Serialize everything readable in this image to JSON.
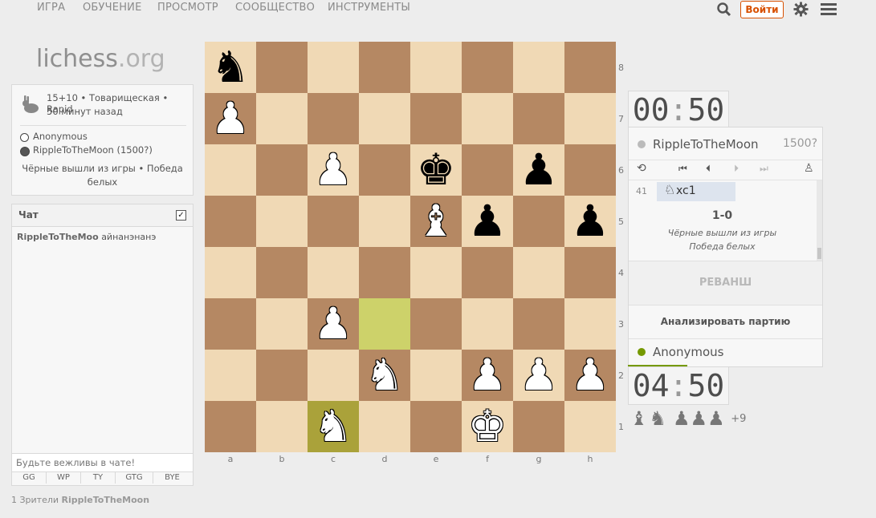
{
  "nav": {
    "items": [
      "ИГРА",
      "ОБУЧЕНИЕ",
      "ПРОСМОТР",
      "СООБЩЕСТВО",
      "ИНСТРУМЕНТЫ"
    ],
    "login_label": "Войти"
  },
  "logo": {
    "main": "lichess",
    "suffix": ".org"
  },
  "game_info": {
    "mode": "15+10 • Товарищеская • Rapid",
    "time_ago": "50 минут назад",
    "white_player": "Anonymous",
    "black_player": "RippleToTheMoon (1500?)",
    "result_text": "Чёрные вышли из игры • Победа белых"
  },
  "chat": {
    "title": "Чат",
    "message_user": "RippleToTheMoo",
    "message_text": "айнанэнанэ",
    "input_placeholder": "Будьте вежливы в чате!",
    "presets": [
      "GG",
      "WP",
      "TY",
      "GTG",
      "BYE"
    ]
  },
  "spectators": {
    "count_label": "1 Зрители",
    "user": "RippleToTheMoon"
  },
  "board": {
    "files": [
      "a",
      "b",
      "c",
      "d",
      "e",
      "f",
      "g",
      "h"
    ],
    "ranks": [
      "8",
      "7",
      "6",
      "5",
      "4",
      "3",
      "2",
      "1"
    ],
    "pieces": [
      {
        "sq": "a8",
        "glyph": "♞",
        "color": "black",
        "name": "black-knight-a8"
      },
      {
        "sq": "a7",
        "glyph": "♟",
        "color": "white",
        "name": "white-pawn-a7"
      },
      {
        "sq": "c6",
        "glyph": "♟",
        "color": "white",
        "name": "white-pawn-c6"
      },
      {
        "sq": "e6",
        "glyph": "♚",
        "color": "black",
        "name": "black-king-e6"
      },
      {
        "sq": "g6",
        "glyph": "♟",
        "color": "black",
        "name": "black-pawn-g6"
      },
      {
        "sq": "e5",
        "glyph": "♝",
        "color": "white",
        "name": "white-bishop-e5"
      },
      {
        "sq": "f5",
        "glyph": "♟",
        "color": "black",
        "name": "black-pawn-f5"
      },
      {
        "sq": "h5",
        "glyph": "♟",
        "color": "black",
        "name": "black-pawn-h5"
      },
      {
        "sq": "c3",
        "glyph": "♟",
        "color": "white",
        "name": "white-pawn-c3"
      },
      {
        "sq": "d2",
        "glyph": "♞",
        "color": "white",
        "name": "white-knight-d2"
      },
      {
        "sq": "f2",
        "glyph": "♟",
        "color": "white",
        "name": "white-pawn-f2"
      },
      {
        "sq": "g2",
        "glyph": "♟",
        "color": "white",
        "name": "white-pawn-g2"
      },
      {
        "sq": "h2",
        "glyph": "♟",
        "color": "white",
        "name": "white-pawn-h2"
      },
      {
        "sq": "c1",
        "glyph": "♞",
        "color": "white",
        "name": "white-knight-c1"
      },
      {
        "sq": "f1",
        "glyph": "♚",
        "color": "white",
        "name": "white-king-f1"
      }
    ],
    "highlights": [
      {
        "sq": "d3",
        "kind": "from"
      },
      {
        "sq": "c1",
        "kind": "to"
      }
    ]
  },
  "clocks": {
    "top_min": "00",
    "top_sec": "50",
    "bottom_min": "04",
    "bottom_sec": "50"
  },
  "players": {
    "top_name": "RippleToTheMoon",
    "top_rating": "1500?",
    "bottom_name": "Anonymous"
  },
  "moves": {
    "number": "41",
    "last_move": "xc1",
    "last_move_piece": "♘"
  },
  "result": {
    "score": "1-0",
    "line1": "Чёрные вышли из игры",
    "line2": "Победа белых"
  },
  "buttons": {
    "rematch": "РЕВАНШ",
    "analyze": "Анализировать партию"
  },
  "material": {
    "extra": "+9"
  },
  "colors": {
    "light": "#f0d9b5",
    "dark": "#b58863",
    "highlight": "#cdd26a",
    "accent": "#759900",
    "login": "#d85000"
  }
}
